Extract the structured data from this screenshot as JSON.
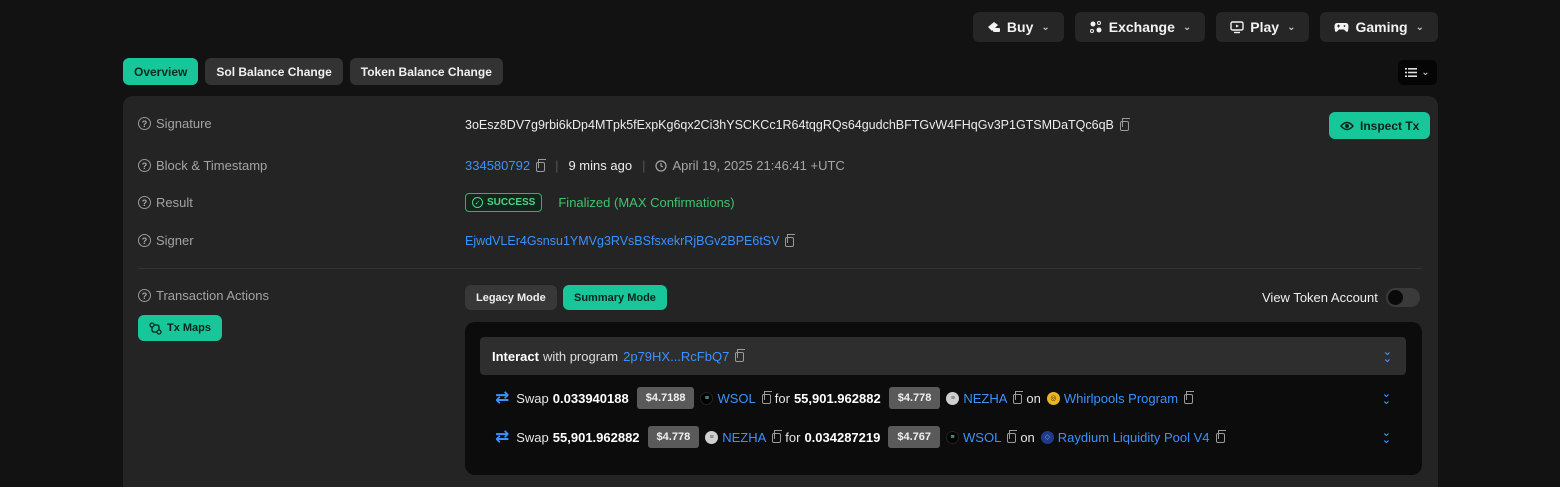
{
  "topnav": [
    {
      "label": "Buy",
      "icon": "wallet-icon"
    },
    {
      "label": "Exchange",
      "icon": "exchange-icon"
    },
    {
      "label": "Play",
      "icon": "play-screen-icon"
    },
    {
      "label": "Gaming",
      "icon": "gamepad-icon"
    }
  ],
  "tabs": [
    "Overview",
    "Sol Balance Change",
    "Token Balance Change"
  ],
  "fields": {
    "signature_label": "Signature",
    "signature": "3oEsz8DV7g9rbi6kDp4MTpk5fExpKg6qx2Ci3hYSCKCc1R64tqgRQs64gudchBFTGvW4FHqGv3P1GTSMDaTQc6qB",
    "block_label": "Block & Timestamp",
    "block": "334580792",
    "ago": "9 mins ago",
    "timestamp": "April 19, 2025 21:46:41 +UTC",
    "result_label": "Result",
    "result_badge": "SUCCESS",
    "result_text": "Finalized (MAX Confirmations)",
    "signer_label": "Signer",
    "signer": "EjwdVLEr4Gsnsu1YMVg3RVsBSfsxekrRjBGv2BPE6tSV",
    "actions_label": "Transaction Actions"
  },
  "buttons": {
    "inspect": "Inspect Tx",
    "txmaps": "Tx Maps",
    "legacy": "Legacy Mode",
    "summary": "Summary Mode",
    "view_token_account": "View Token Account"
  },
  "interact": {
    "bold": "Interact",
    "text": "with program",
    "program": "2p79HX...RcFbQ7"
  },
  "swaps": [
    {
      "word": "Swap",
      "amount_in": "0.033940188",
      "price_in": "$4.7188",
      "token_in": "WSOL",
      "for": "for",
      "amount_out": "55,901.962882",
      "price_out": "$4.778",
      "token_out": "NEZHA",
      "on": "on",
      "program": "Whirlpools Program"
    },
    {
      "word": "Swap",
      "amount_in": "55,901.962882",
      "price_in": "$4.778",
      "token_in": "NEZHA",
      "for": "for",
      "amount_out": "0.034287219",
      "price_out": "$4.767",
      "token_out": "WSOL",
      "on": "on",
      "program": "Raydium Liquidity Pool V4"
    }
  ],
  "colors": {
    "accent": "#17c799",
    "link": "#3b92ff",
    "success": "#52d18b",
    "background": "#121212",
    "card": "#242424"
  }
}
